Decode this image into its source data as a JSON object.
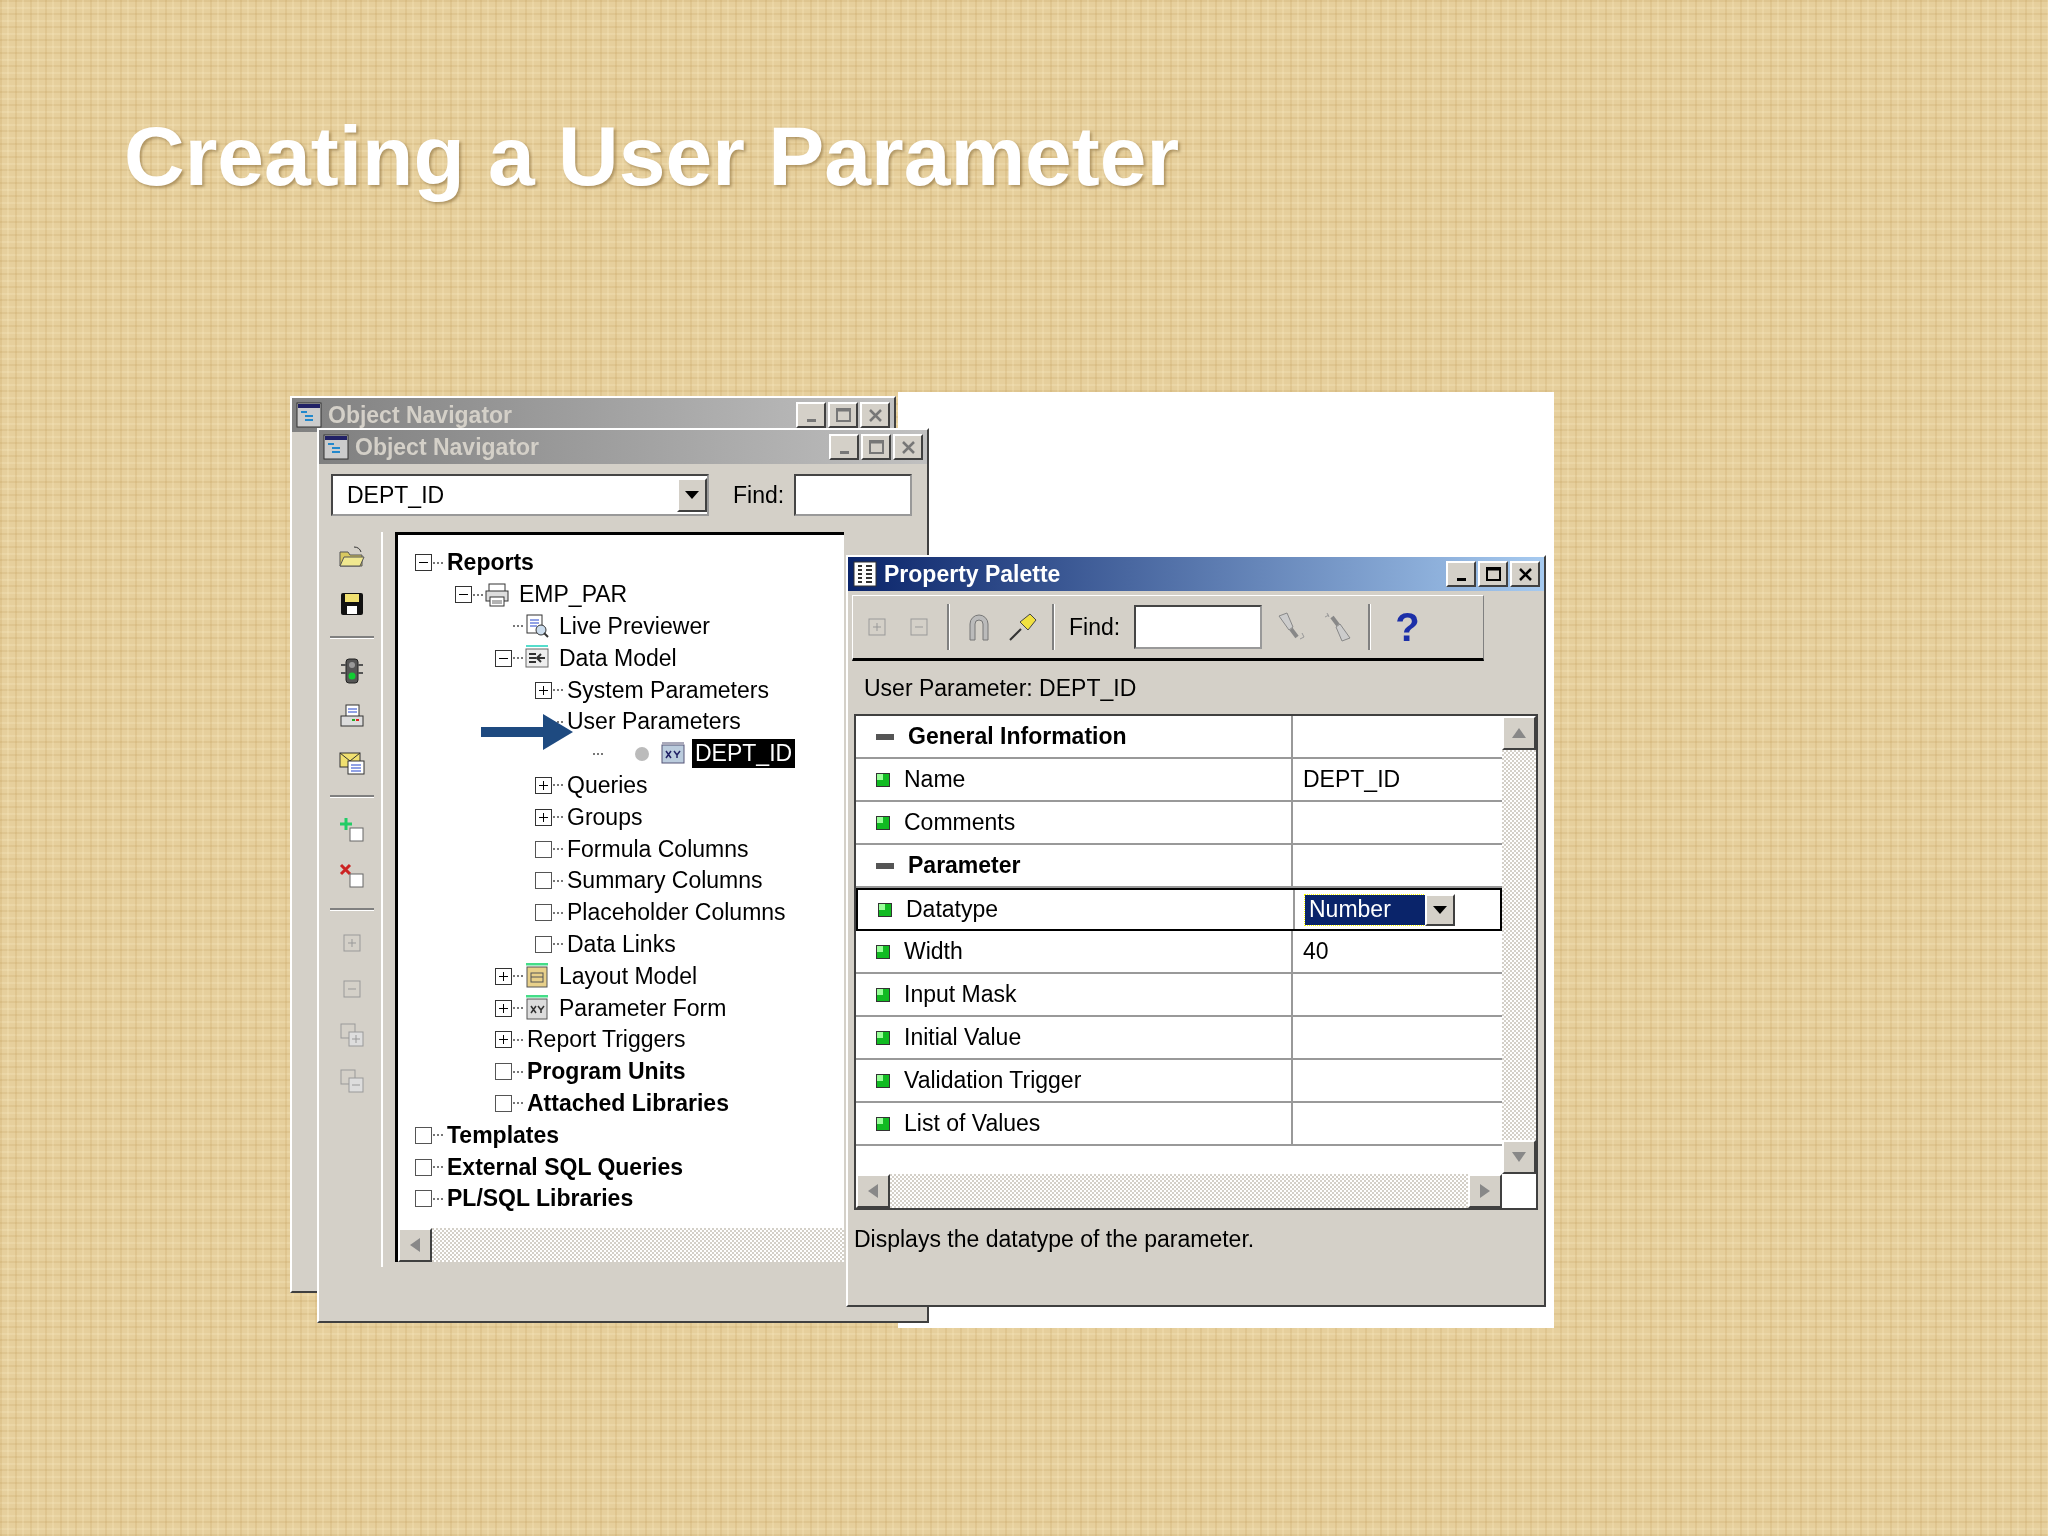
{
  "slide": {
    "title": "Creating a User Parameter"
  },
  "back_window": {
    "title": "Object Navigator"
  },
  "navigator": {
    "title": "Object Navigator",
    "location": "DEPT_ID",
    "find_label": "Find:",
    "tree": [
      {
        "label": "Reports",
        "bold": true,
        "expanded": true,
        "selected": false,
        "children": [
          {
            "label": "EMP_PAR",
            "bold": false,
            "expanded": true,
            "selected": false,
            "kind": "report",
            "children": [
              {
                "label": "Live Previewer",
                "bold": false,
                "selected": false,
                "kind": "previewer"
              },
              {
                "label": "Data Model",
                "bold": false,
                "expanded": true,
                "selected": false,
                "kind": "data-model",
                "children": [
                  {
                    "label": "System Parameters",
                    "bold": false,
                    "expanded": false,
                    "selected": false
                  },
                  {
                    "label": "User Parameters",
                    "bold": false,
                    "selected": false,
                    "children": [
                      {
                        "label": "DEPT_ID",
                        "bold": false,
                        "selected": true,
                        "kind": "parameter"
                      }
                    ]
                  },
                  {
                    "label": "Queries",
                    "bold": false,
                    "expanded": false,
                    "selected": false
                  },
                  {
                    "label": "Groups",
                    "bold": false,
                    "expanded": false,
                    "selected": false
                  },
                  {
                    "label": "Formula Columns",
                    "bold": false,
                    "empty": true,
                    "selected": false
                  },
                  {
                    "label": "Summary Columns",
                    "bold": false,
                    "empty": true,
                    "selected": false
                  },
                  {
                    "label": "Placeholder Columns",
                    "bold": false,
                    "empty": true,
                    "selected": false
                  },
                  {
                    "label": "Data Links",
                    "bold": false,
                    "empty": true,
                    "selected": false
                  }
                ]
              },
              {
                "label": "Layout Model",
                "bold": false,
                "expanded": false,
                "selected": false,
                "kind": "layout"
              },
              {
                "label": "Parameter Form",
                "bold": false,
                "expanded": false,
                "selected": false,
                "kind": "param-form"
              },
              {
                "label": "Report Triggers",
                "bold": false,
                "expanded": false,
                "selected": false
              },
              {
                "label": "Program Units",
                "bold": true,
                "empty": true,
                "selected": false
              },
              {
                "label": "Attached Libraries",
                "bold": true,
                "empty": true,
                "selected": false
              }
            ]
          }
        ]
      },
      {
        "label": "Templates",
        "bold": true,
        "empty": true,
        "selected": false
      },
      {
        "label": "External SQL Queries",
        "bold": true,
        "empty": true,
        "selected": false
      },
      {
        "label": "PL/SQL Libraries",
        "bold": true,
        "empty": true,
        "selected": false
      }
    ]
  },
  "palette": {
    "title": "Property Palette",
    "find_label": "Find:",
    "help": "?",
    "object": "User Parameter: DEPT_ID",
    "rows": [
      {
        "kind": "section",
        "label": "General Information",
        "expanded": true
      },
      {
        "kind": "property",
        "label": "Name",
        "value": "DEPT_ID",
        "selected": false
      },
      {
        "kind": "property",
        "label": "Comments",
        "selected": false
      },
      {
        "kind": "section",
        "label": "Parameter",
        "expanded": true
      },
      {
        "kind": "property",
        "label": "Datatype",
        "value": "Number",
        "selected": true
      },
      {
        "kind": "property",
        "label": "Width",
        "value": "40",
        "selected": false
      },
      {
        "kind": "property",
        "label": "Input Mask",
        "selected": false
      },
      {
        "kind": "property",
        "label": "Initial Value",
        "selected": false
      },
      {
        "kind": "property",
        "label": "Validation Trigger",
        "selected": false
      },
      {
        "kind": "property",
        "label": "List of Values",
        "selected": false
      }
    ],
    "hint": "Displays the datatype of the parameter."
  }
}
